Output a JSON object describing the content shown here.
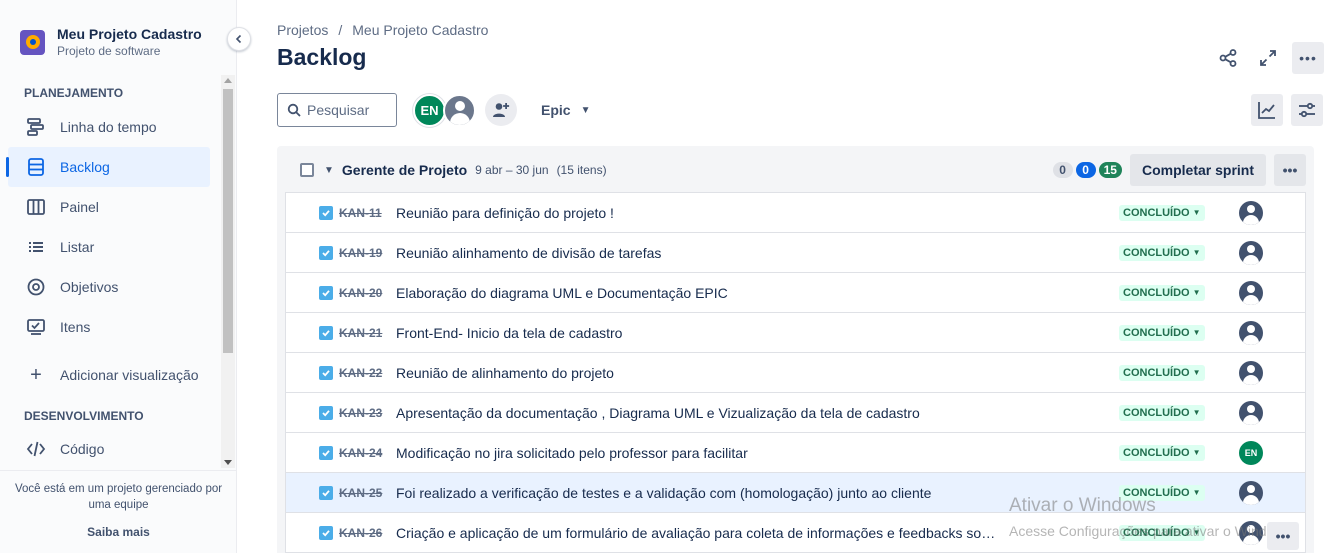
{
  "project": {
    "name": "Meu Projeto Cadastro",
    "type": "Projeto de software"
  },
  "sidebar": {
    "planning_title": "PLANEJAMENTO",
    "items": [
      {
        "label": "Linha do tempo",
        "icon": "timeline-icon"
      },
      {
        "label": "Backlog",
        "icon": "backlog-icon",
        "active": true
      },
      {
        "label": "Painel",
        "icon": "board-icon"
      },
      {
        "label": "Listar",
        "icon": "list-icon"
      },
      {
        "label": "Objetivos",
        "icon": "goals-icon"
      },
      {
        "label": "Itens",
        "icon": "items-icon"
      }
    ],
    "add_view": "Adicionar visualização",
    "dev_title": "DESENVOLVIMENTO",
    "code": "Código",
    "footer_text": "Você está em um projeto gerenciado por uma equipe",
    "footer_link": "Saiba mais"
  },
  "breadcrumb": {
    "root": "Projetos",
    "sep": "/",
    "current": "Meu Projeto Cadastro"
  },
  "page_title": "Backlog",
  "toolbar": {
    "search_placeholder": "Pesquisar",
    "avatar_initials": "EN",
    "epic_label": "Epic"
  },
  "sprint": {
    "name": "Gerente de Projeto",
    "dates": "9 abr – 30 jun",
    "count": "(15 itens)",
    "todo": "0",
    "in_progress": "0",
    "done": "15",
    "complete_label": "Completar sprint",
    "more": "•••"
  },
  "issues": [
    {
      "key": "KAN-11",
      "summary": "Reunião para definição do projeto !",
      "status": "CONCLUÍDO",
      "assignee": ""
    },
    {
      "key": "KAN-19",
      "summary": "Reunião alinhamento de divisão de tarefas",
      "status": "CONCLUÍDO",
      "assignee": ""
    },
    {
      "key": "KAN-20",
      "summary": "Elaboração do diagrama UML e Documentação EPIC",
      "status": "CONCLUÍDO",
      "assignee": ""
    },
    {
      "key": "KAN-21",
      "summary": "Front-End- Inicio da tela de cadastro",
      "status": "CONCLUÍDO",
      "assignee": ""
    },
    {
      "key": "KAN-22",
      "summary": "Reunião de alinhamento do projeto",
      "status": "CONCLUÍDO",
      "assignee": ""
    },
    {
      "key": "KAN-23",
      "summary": "Apresentação da documentação , Diagrama UML e Vizualização da tela de cadastro",
      "status": "CONCLUÍDO",
      "assignee": ""
    },
    {
      "key": "KAN-24",
      "summary": "Modificação no jira solicitado pelo professor para facilitar",
      "status": "CONCLUÍDO",
      "assignee": "EN"
    },
    {
      "key": "KAN-25",
      "summary": "Foi realizado a verificação de testes e a validação com (homologação) junto ao cliente",
      "status": "CONCLUÍDO",
      "assignee": "",
      "selected": true
    },
    {
      "key": "KAN-26",
      "summary": "Criação e aplicação de um formulário de avaliação para coleta de informações e feedbacks sobr...",
      "status": "CONCLUÍDO",
      "assignee": ""
    }
  ],
  "watermark": {
    "title": "Ativar o Windows",
    "subtitle": "Acesse Configurações para ativar o Windows."
  },
  "colors": {
    "accent": "#0c66e4",
    "done_bg": "#dcfff1",
    "done_text": "#216e4e",
    "en_avatar": "#00875a"
  }
}
